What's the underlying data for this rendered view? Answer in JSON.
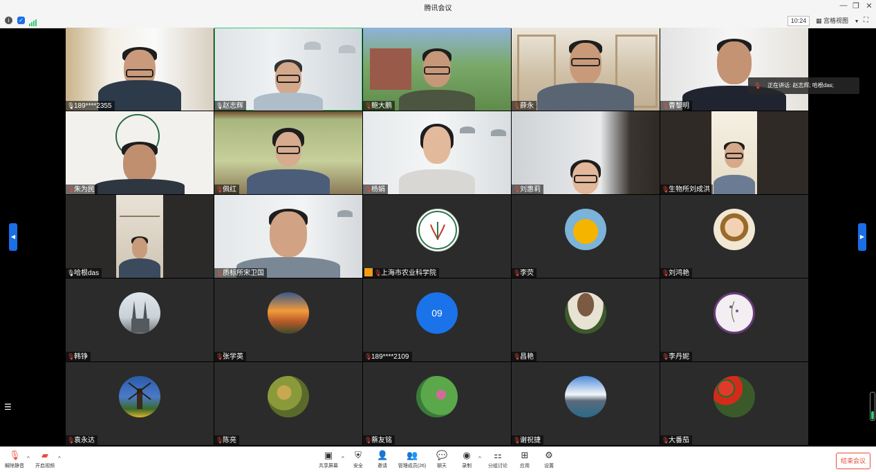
{
  "window": {
    "title": "腾讯会议"
  },
  "topbar": {
    "time": "10:24",
    "view_label": "宫格视图"
  },
  "speaking": {
    "text": "正在讲话: 赵志辉; 哈根das;"
  },
  "participants": [
    {
      "name": "189****2355",
      "mic": "on"
    },
    {
      "name": "赵志辉",
      "mic": "on"
    },
    {
      "name": "鲍大鹏",
      "mic": "muted"
    },
    {
      "name": "薛永",
      "mic": "muted"
    },
    {
      "name": "曹黎明",
      "mic": "muted"
    },
    {
      "name": "朱为民",
      "mic": "muted"
    },
    {
      "name": "佩红",
      "mic": "muted"
    },
    {
      "name": "杨娟",
      "mic": "muted"
    },
    {
      "name": "刘惠莉",
      "mic": "muted"
    },
    {
      "name": "生物所刘成洪",
      "mic": "muted"
    },
    {
      "name": "哈根das",
      "mic": "on"
    },
    {
      "name": "质标所宋卫国",
      "mic": "muted"
    },
    {
      "name": "上海市农业科学院",
      "mic": "muted",
      "host": true
    },
    {
      "name": "李荧",
      "mic": "muted"
    },
    {
      "name": "刘鸿艳",
      "mic": "muted"
    },
    {
      "name": "韩铮",
      "mic": "muted"
    },
    {
      "name": "张学英",
      "mic": "muted"
    },
    {
      "name": "189****2109",
      "mic": "muted",
      "avatar_text": "09"
    },
    {
      "name": "昌艳",
      "mic": "muted"
    },
    {
      "name": "李丹妮",
      "mic": "muted"
    },
    {
      "name": "袁永达",
      "mic": "muted"
    },
    {
      "name": "陈亮",
      "mic": "muted"
    },
    {
      "name": "蔡友铭",
      "mic": "muted"
    },
    {
      "name": "谢祝捷",
      "mic": "muted"
    },
    {
      "name": "大番茄",
      "mic": "muted"
    }
  ],
  "toolbar": {
    "unmute": "解除静音",
    "start_video": "开启视频",
    "share_screen": "共享屏幕",
    "security": "安全",
    "invite": "邀请",
    "manage_members": "管理成员(26)",
    "chat": "聊天",
    "record": "录制",
    "breakout": "分组讨论",
    "apps": "应用",
    "settings": "设置",
    "end_meeting": "结束会议"
  },
  "colors": {
    "accent": "#1a6ee6",
    "end": "#e74c3c",
    "active_border": "#2ecc71"
  }
}
